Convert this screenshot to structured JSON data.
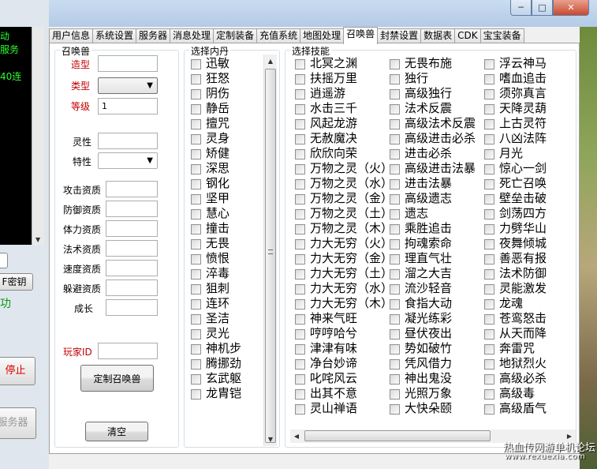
{
  "left_window": {
    "console_lines": [
      "动",
      "服务",
      "40连"
    ],
    "key_button": "F密钥",
    "status_text": "功",
    "stop_button": "停止",
    "server_button": "服务器"
  },
  "tabs": [
    "用户信息",
    "系统设置",
    "服务器",
    "消息处理",
    "定制装备",
    "充值系统",
    "地图处理",
    "召唤兽",
    "封禁设置",
    "数据表",
    "CDK",
    "宝宝装备"
  ],
  "active_tab": "召唤兽",
  "summon": {
    "group_label": "召唤兽",
    "model_label": "造型",
    "model_value": "",
    "type_label": "类型",
    "type_value": "",
    "level_label": "等级",
    "level_value": "1",
    "spirit_label": "灵性",
    "spirit_value": "",
    "trait_label": "特性",
    "trait_value": "",
    "attack_label": "攻击资质",
    "attack_value": "",
    "defense_label": "防御资质",
    "defense_value": "",
    "stamina_label": "体力资质",
    "stamina_value": "",
    "magic_label": "法术资质",
    "magic_value": "",
    "speed_label": "速度资质",
    "speed_value": "",
    "dodge_label": "躲避资质",
    "dodge_value": "",
    "growth_label": "成长",
    "growth_value": "",
    "player_id_label": "玩家ID",
    "player_id_value": "",
    "custom_button": "定制召唤兽",
    "clear_button": "清空"
  },
  "neidan": {
    "group_label": "选择内丹",
    "items": [
      "迅敏",
      "狂怒",
      "阴伤",
      "静岳",
      "擅咒",
      "灵身",
      "矫健",
      "深思",
      "钢化",
      "坚甲",
      "慧心",
      "撞击",
      "无畏",
      "愤恨",
      "淬毒",
      "狙刺",
      "连环",
      "圣洁",
      "灵光",
      "神机步",
      "腾挪劲",
      "玄武躯",
      "龙胄铠"
    ]
  },
  "skills": {
    "group_label": "选择技能",
    "columns": [
      [
        "北冥之渊",
        "扶摇万里",
        "逍遥游",
        "水击三千",
        "风起龙游",
        "无赦魔决",
        "欣欣向荣",
        "万物之灵（火）",
        "万物之灵（水）",
        "万物之灵（金）",
        "万物之灵（土）",
        "万物之灵（木）",
        "力大无穷（火）",
        "力大无穷（金）",
        "力大无穷（土）",
        "力大无穷（水）",
        "力大无穷（木）",
        "神来气旺",
        "哼哼哈兮",
        "津津有味",
        "净台妙谛",
        "叱咤风云",
        "出其不意",
        "灵山禅语"
      ],
      [
        "无畏布施",
        "独行",
        "高级独行",
        "法术反震",
        "高级法术反震",
        "高级进击必杀",
        "进击必杀",
        "高级进击法暴",
        "进击法暴",
        "高级遗志",
        "遗志",
        "乘胜追击",
        "拘魂索命",
        "理直气壮",
        "溜之大吉",
        "流沙轻音",
        "食指大动",
        "凝光练彩",
        "昼伏夜出",
        "势如破竹",
        "凭风借力",
        "神出鬼没",
        "光照万象",
        "大快朵颐"
      ],
      [
        "浮云神马",
        "嗜血追击",
        "须弥真言",
        "天降灵葫",
        "上古灵符",
        "八凶法阵",
        "月光",
        "惊心一剑",
        "死亡召唤",
        "壁垒击破",
        "剑荡四方",
        "力劈华山",
        "夜舞倾城",
        "善恶有报",
        "法术防御",
        "灵能激发",
        "龙魂",
        "苍鸾怒击",
        "从天而降",
        "奔雷咒",
        "地狱烈火",
        "高级必杀",
        "高级毒",
        "高级盾气"
      ]
    ]
  },
  "watermark": {
    "line1": "热血传网游单机论坛",
    "line2": "www.rexuexia.com"
  }
}
